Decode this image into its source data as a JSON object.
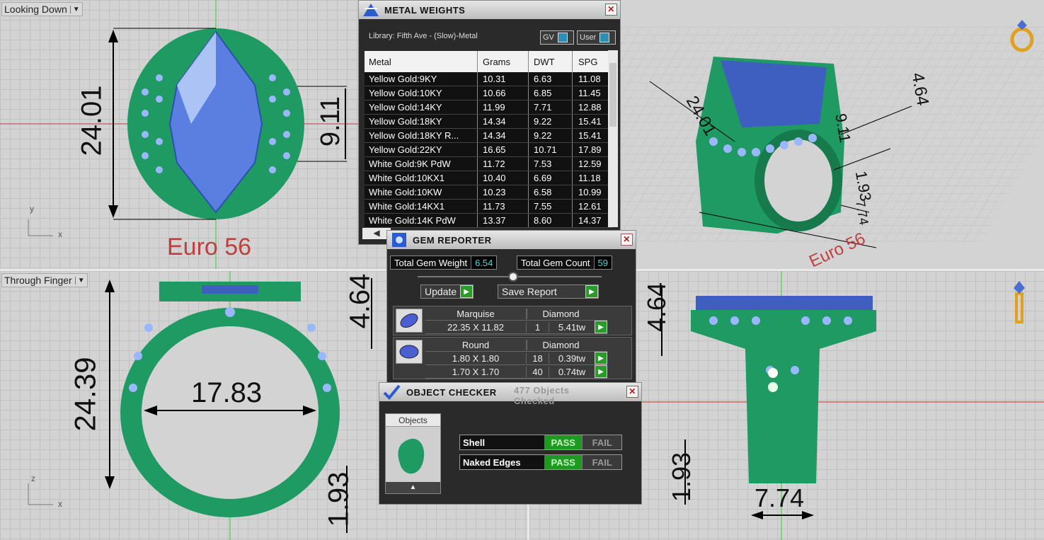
{
  "viewports": {
    "top_left": {
      "label": "Looking Down",
      "axis_y": "y",
      "axis_x": "x",
      "dims": [
        "24.01",
        "9.11"
      ],
      "caption": "Euro 56"
    },
    "top_right": {
      "dims": [
        "24.01",
        "4.64",
        "9.11",
        "1.93",
        "7.74"
      ],
      "caption": "Euro 56"
    },
    "bottom_left": {
      "label": "Through Finger",
      "axis_z": "z",
      "axis_x": "x",
      "dims": [
        "24.39",
        "17.83",
        "4.64",
        "1.93"
      ]
    },
    "bottom_right": {
      "dims": [
        "4.64",
        "1.93",
        "7.74"
      ]
    }
  },
  "metal_weights": {
    "title": "METAL WEIGHTS",
    "library": "Library: Fifth Ave - (Slow)-Metal",
    "toggle_gv": "GV",
    "toggle_user": "User",
    "columns": [
      "Metal",
      "Grams",
      "DWT",
      "SPG"
    ],
    "rows": [
      [
        "Yellow Gold:9KY",
        "10.31",
        "6.63",
        "11.08"
      ],
      [
        "Yellow Gold:10KY",
        "10.66",
        "6.85",
        "11.45"
      ],
      [
        "Yellow Gold:14KY",
        "11.99",
        "7.71",
        "12.88"
      ],
      [
        "Yellow Gold:18KY",
        "14.34",
        "9.22",
        "15.41"
      ],
      [
        "Yellow Gold:18KY R...",
        "14.34",
        "9.22",
        "15.41"
      ],
      [
        "Yellow Gold:22KY",
        "16.65",
        "10.71",
        "17.89"
      ],
      [
        "White Gold:9K PdW",
        "11.72",
        "7.53",
        "12.59"
      ],
      [
        "White Gold:10KX1",
        "10.40",
        "6.69",
        "11.18"
      ],
      [
        "White Gold:10KW",
        "10.23",
        "6.58",
        "10.99"
      ],
      [
        "White Gold:14KX1",
        "11.73",
        "7.55",
        "12.61"
      ],
      [
        "White Gold:14K PdW",
        "13.37",
        "8.60",
        "14.37"
      ]
    ]
  },
  "gem_reporter": {
    "title": "GEM REPORTER",
    "total_weight_label": "Total Gem Weight",
    "total_weight": "6.54",
    "total_count_label": "Total Gem Count",
    "total_count": "59",
    "update_label": "Update",
    "save_label": "Save Report",
    "groups": [
      {
        "shape": "Marquise",
        "type": "Diamond",
        "rows": [
          [
            "22.35 X 11.82",
            "1",
            "5.41tw"
          ]
        ]
      },
      {
        "shape": "Round",
        "type": "Diamond",
        "rows": [
          [
            "1.80 X 1.80",
            "18",
            "0.39tw"
          ],
          [
            "1.70 X 1.70",
            "40",
            "0.74tw"
          ]
        ]
      }
    ]
  },
  "object_checker": {
    "title": "OBJECT CHECKER",
    "count_text": "477 Objects Checked",
    "objects_label": "Objects",
    "checks": [
      {
        "name": "Shell",
        "pass": "PASS",
        "fail": "FAIL"
      },
      {
        "name": "Naked Edges",
        "pass": "PASS",
        "fail": "FAIL"
      }
    ]
  },
  "colors": {
    "ring_green": "#1f9a63",
    "gem_blue": "#5a7fe0",
    "pass_green": "#1e9a1e",
    "caption_red": "#c04040"
  }
}
